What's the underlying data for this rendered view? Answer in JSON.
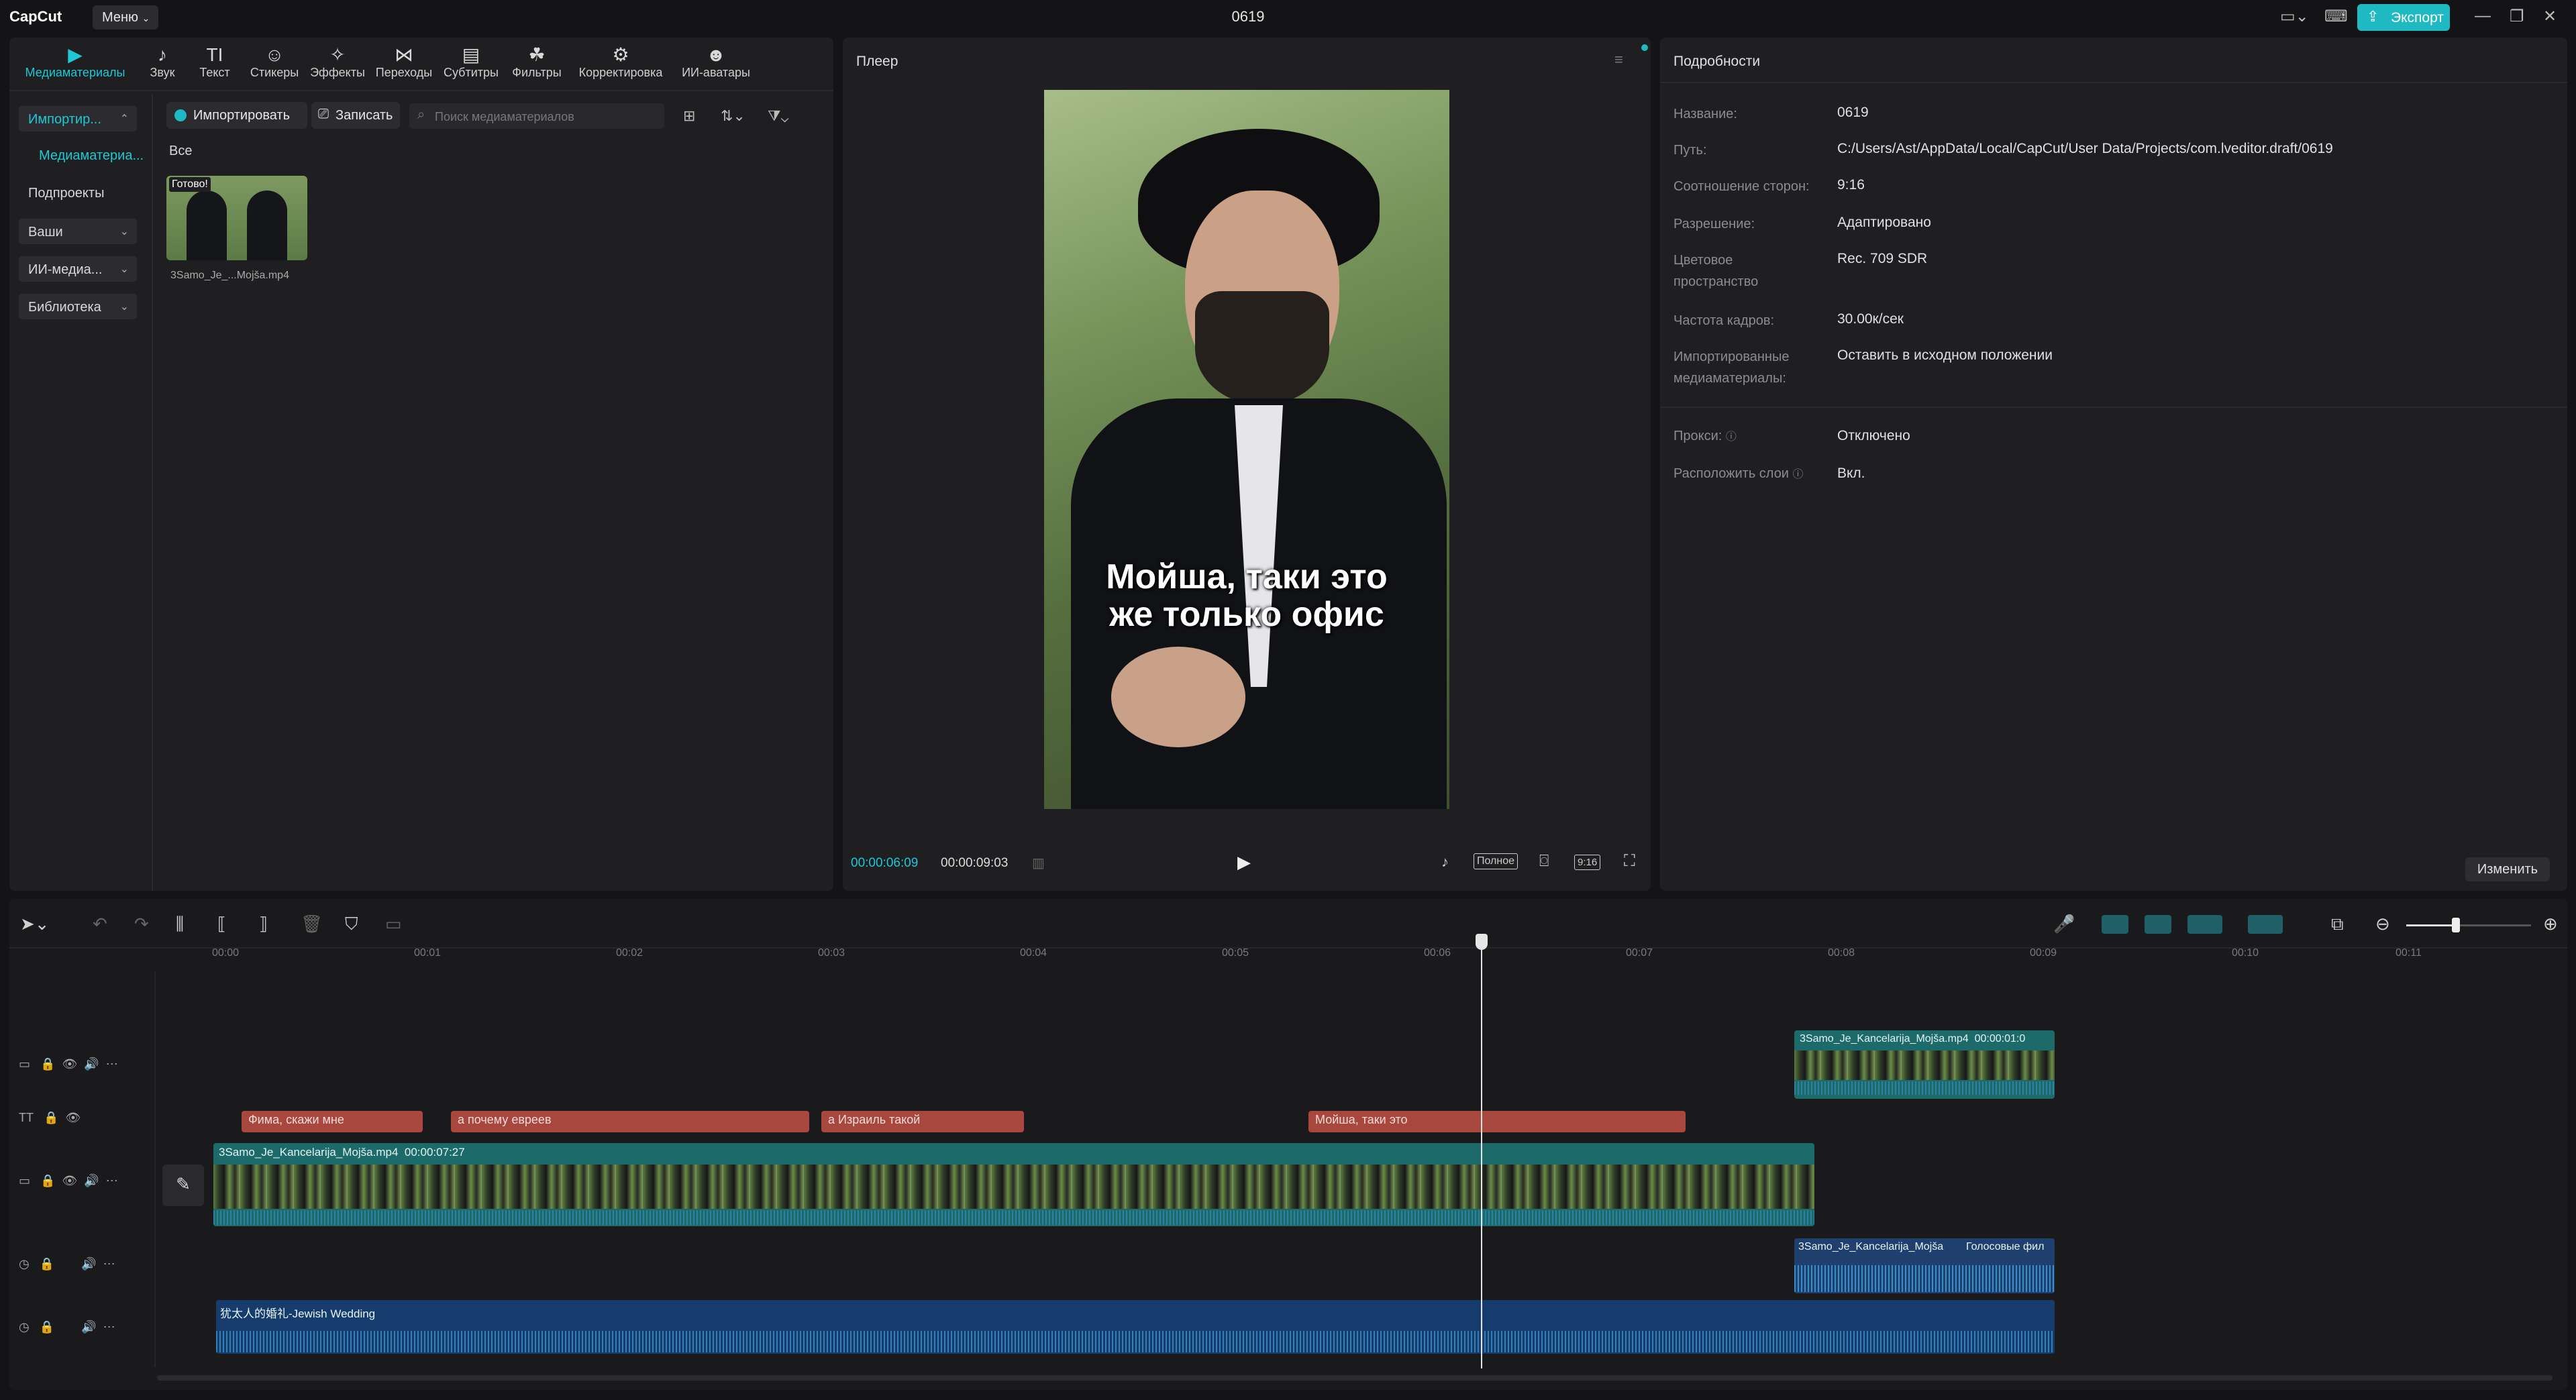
{
  "app": {
    "logo": "CapCut",
    "menu_label": "Меню",
    "project_title": "0619",
    "export_label": "Экспорт"
  },
  "tools": [
    {
      "label": "Медиаматериалы",
      "icon": "▶"
    },
    {
      "label": "Звук",
      "icon": "♪"
    },
    {
      "label": "Текст",
      "icon": "TI"
    },
    {
      "label": "Стикеры",
      "icon": "☺"
    },
    {
      "label": "Эффекты",
      "icon": "✧"
    },
    {
      "label": "Переходы",
      "icon": "⋈"
    },
    {
      "label": "Субтитры",
      "icon": "▤"
    },
    {
      "label": "Фильтры",
      "icon": "☘"
    },
    {
      "label": "Корректировка",
      "icon": "⚙"
    },
    {
      "label": "ИИ-аватары",
      "icon": "☻"
    }
  ],
  "sidebar": {
    "import": "Импортир...",
    "media": "Медиаматериа...",
    "subprojects": "Подпроекты",
    "yours": "Ваши",
    "ai_media": "ИИ-медиа...",
    "library": "Библиотека"
  },
  "media": {
    "import_btn": "Импортировать",
    "record_btn": "Записать",
    "search_placeholder": "Поиск медиаматериалов",
    "filter_all": "Все",
    "item_badge": "Готово!",
    "item_name": "3Samo_Je_...Mojša.mp4"
  },
  "player": {
    "title": "Плеер",
    "subtitle_line1": "Мойша, таки это",
    "subtitle_line2": "же только офис",
    "current_time": "00:00:06:09",
    "total_time": "00:00:09:03",
    "full_label": "Полное",
    "ratio_label": "9:16"
  },
  "details": {
    "title": "Подробности",
    "fields": [
      {
        "label": "Название:",
        "value": "0619"
      },
      {
        "label": "Путь:",
        "value": "C:/Users/Ast/AppData/Local/CapCut/User Data/Projects/com.lveditor.draft/0619"
      },
      {
        "label": "Соотношение сторон:",
        "value": "9:16"
      },
      {
        "label": "Разрешение:",
        "value": "Адаптировано"
      },
      {
        "label": "Цветовое пространство",
        "value": "Rec. 709 SDR"
      },
      {
        "label": "Частота кадров:",
        "value": "30.00к/сек"
      },
      {
        "label": "Импортированные медиаматериалы:",
        "value": "Оставить в исходном положении"
      },
      {
        "label": "Прокси:",
        "value": "Отключено"
      },
      {
        "label": "Расположить слои",
        "value": "Вкл."
      }
    ],
    "change_btn": "Изменить"
  },
  "timeline": {
    "ruler": [
      "00:00",
      "00:01",
      "00:02",
      "00:03",
      "00:04",
      "00:05",
      "00:06",
      "00:07",
      "00:08",
      "00:09",
      "00:10",
      "00:11"
    ],
    "text_clips": [
      "Фима, скажи мне",
      "а почему евреев",
      "а Израиль такой",
      "Мойша, таки это"
    ],
    "main_clip": {
      "name": "3Samo_Je_Kancelarija_Mojša.mp4",
      "duration": "00:00:07:27"
    },
    "overlay_clip": {
      "name": "3Samo_Je_Kancelarija_Mojša.mp4",
      "duration": "00:00:01:0"
    },
    "audio_clip1": {
      "name": "3Samo_Je_Kancelarija_Mojša",
      "extra": "Голосовые фил"
    },
    "audio_clip2": {
      "name": "犹太人的婚礼-Jewish Wedding"
    }
  }
}
